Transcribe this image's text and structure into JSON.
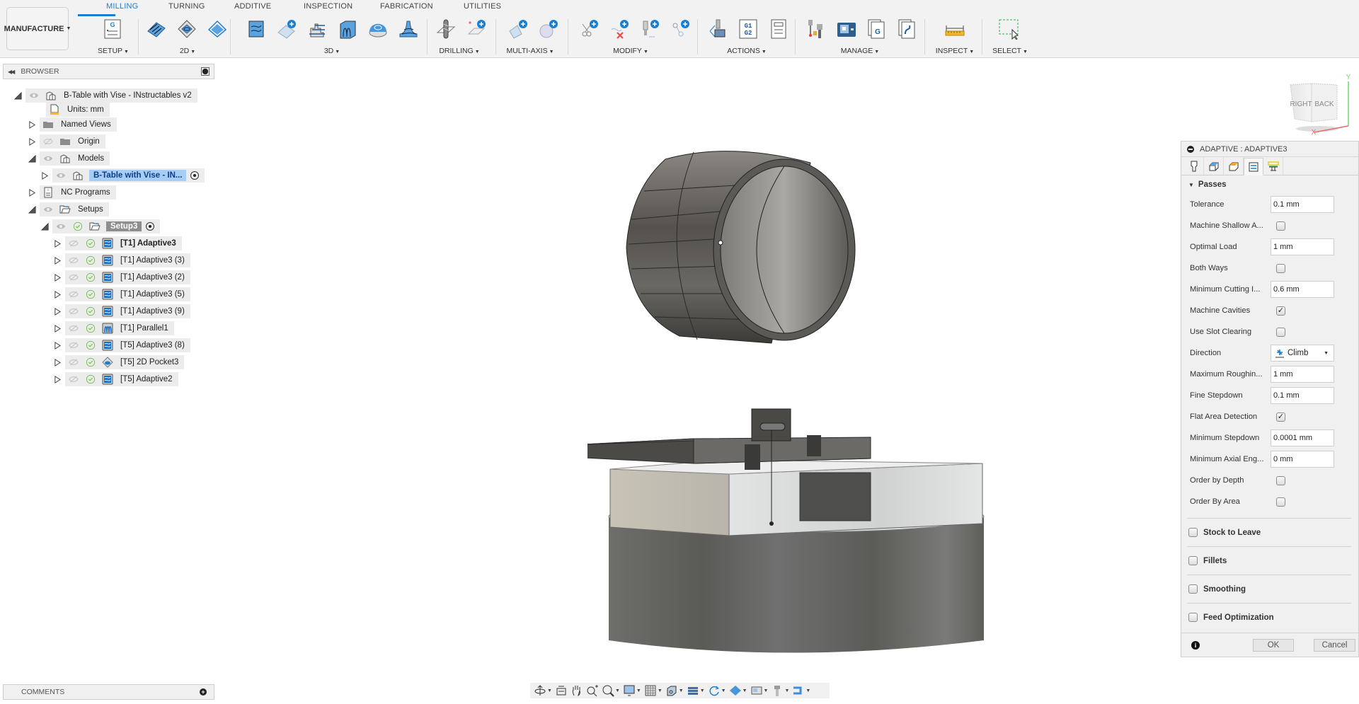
{
  "toolbar": {
    "workspace": "MANUFACTURE",
    "tabs": [
      {
        "label": "MILLING",
        "active": true
      },
      {
        "label": "TURNING",
        "active": false
      },
      {
        "label": "ADDITIVE",
        "active": false
      },
      {
        "label": "INSPECTION",
        "active": false
      },
      {
        "label": "FABRICATION",
        "active": false
      },
      {
        "label": "UTILITIES",
        "active": false
      }
    ],
    "groups": {
      "setup": "SETUP",
      "g2d": "2D",
      "g3d": "3D",
      "drilling": "DRILLING",
      "multiaxis": "MULTI-AXIS",
      "modify": "MODIFY",
      "actions": "ACTIONS",
      "manage": "MANAGE",
      "inspect": "INSPECT",
      "select": "SELECT"
    },
    "g1g2_text": "G1\nG2"
  },
  "browser": {
    "title": "BROWSER",
    "items": [
      {
        "label": "B-Table with Vise - INstructables v2",
        "icon": "component-icon"
      },
      {
        "label": "Units: mm",
        "icon": "units-icon"
      },
      {
        "label": "Named Views",
        "icon": "folder-icon"
      },
      {
        "label": "Origin",
        "icon": "folder-icon"
      },
      {
        "label": "Models",
        "icon": "component-icon"
      },
      {
        "label": "B-Table with Vise - IN...",
        "icon": "component-icon"
      },
      {
        "label": "NC Programs",
        "icon": "nc-program-icon"
      },
      {
        "label": "Setups",
        "icon": "setup-folder-icon"
      },
      {
        "label": "Setup3",
        "icon": "setup-folder-icon"
      }
    ],
    "operations": [
      {
        "label": "[T1] Adaptive3",
        "icon": "adaptive-icon",
        "bold": true
      },
      {
        "label": "[T1] Adaptive3 (3)",
        "icon": "adaptive-icon"
      },
      {
        "label": "[T1] Adaptive3 (2)",
        "icon": "adaptive-icon"
      },
      {
        "label": "[T1] Adaptive3 (5)",
        "icon": "adaptive-icon"
      },
      {
        "label": "[T1] Adaptive3 (9)",
        "icon": "adaptive-icon"
      },
      {
        "label": "[T1] Parallel1",
        "icon": "parallel-icon"
      },
      {
        "label": "[T5] Adaptive3 (8)",
        "icon": "adaptive-icon"
      },
      {
        "label": "[T5] 2D Pocket3",
        "icon": "pocket-icon"
      },
      {
        "label": "[T5] Adaptive2",
        "icon": "adaptive-icon"
      }
    ]
  },
  "comments": {
    "title": "COMMENTS"
  },
  "viewcube": {
    "face_left": "RIGHT",
    "face_right": "BACK",
    "axis_x": "X",
    "axis_y": "Y"
  },
  "panel": {
    "title": "ADAPTIVE : ADAPTIVE3",
    "tabs": [
      "tool-tab",
      "geometry-tab",
      "heights-tab",
      "passes-tab",
      "linking-tab"
    ],
    "active_tab": 3,
    "section": "Passes",
    "fields": {
      "tolerance": {
        "label": "Tolerance",
        "value": "0.1 mm"
      },
      "machine_shallow": {
        "label": "Machine Shallow A...",
        "checked": false
      },
      "optimal_load": {
        "label": "Optimal Load",
        "value": "1 mm"
      },
      "both_ways": {
        "label": "Both Ways",
        "checked": false
      },
      "min_cutting": {
        "label": "Minimum Cutting I...",
        "value": "0.6 mm"
      },
      "machine_cavities": {
        "label": "Machine Cavities",
        "checked": true
      },
      "slot_clearing": {
        "label": "Use Slot Clearing",
        "checked": false
      },
      "direction": {
        "label": "Direction",
        "value": "Climb"
      },
      "max_roughing": {
        "label": "Maximum Roughin...",
        "value": "1 mm"
      },
      "fine_stepdown": {
        "label": "Fine Stepdown",
        "value": "0.1 mm"
      },
      "flat_area": {
        "label": "Flat Area Detection",
        "checked": true
      },
      "min_stepdown": {
        "label": "Minimum Stepdown",
        "value": "0.0001 mm"
      },
      "min_axial": {
        "label": "Minimum Axial Eng...",
        "value": "0 mm"
      },
      "order_depth": {
        "label": "Order by Depth",
        "checked": false
      },
      "order_area": {
        "label": "Order By Area",
        "checked": false
      }
    },
    "sections": {
      "stock_to_leave": "Stock to Leave",
      "fillets": "Fillets",
      "smoothing": "Smoothing",
      "feed_optimization": "Feed Optimization"
    },
    "ok": "OK",
    "cancel": "Cancel"
  },
  "colors": {
    "accent": "#1a7fd1",
    "selection": "#a8cdf5",
    "check_green": "#6cc04a"
  }
}
